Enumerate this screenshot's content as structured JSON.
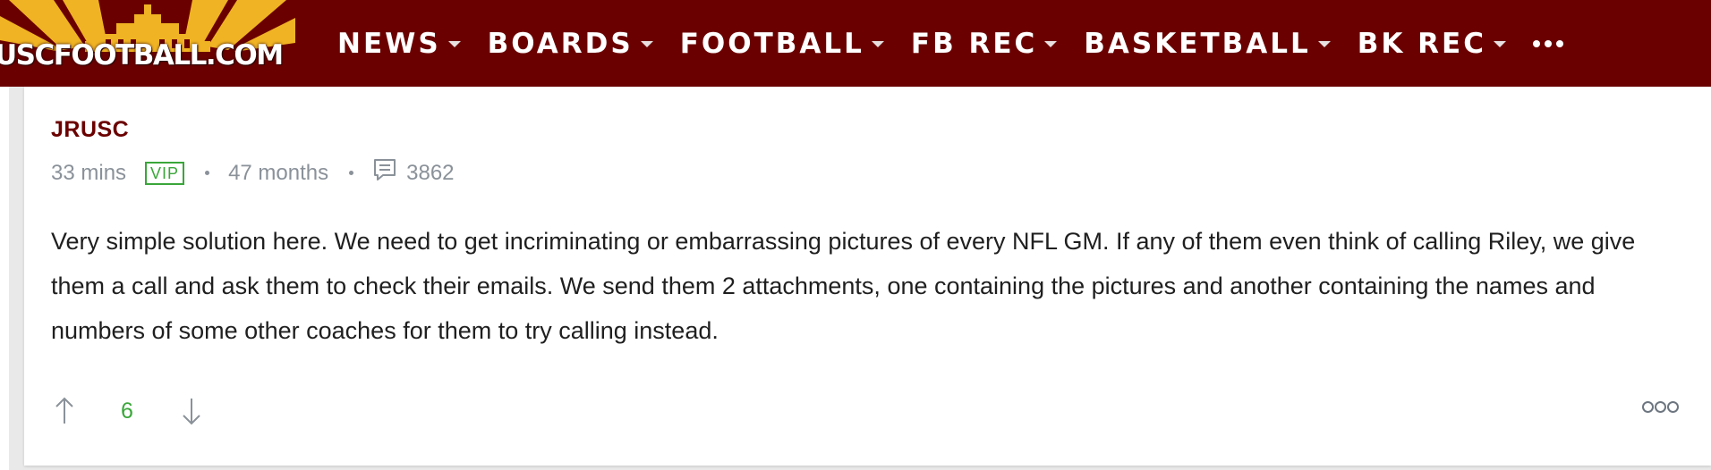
{
  "site": {
    "logo_text": "USCFOOTBALL.COM",
    "colors": {
      "brand": "#6b0000",
      "accent_gold": "#f0b323",
      "vip_green": "#3aa63a",
      "meta_gray": "#8a9199"
    }
  },
  "nav": {
    "items": [
      {
        "label": "NEWS"
      },
      {
        "label": "BOARDS"
      },
      {
        "label": "FOOTBALL"
      },
      {
        "label": "FB REC"
      },
      {
        "label": "BASKETBALL"
      },
      {
        "label": "BK REC"
      }
    ],
    "more_icon": "more-horizontal-icon"
  },
  "post": {
    "username": "JRUSC",
    "time_ago": "33 mins",
    "badge": "VIP",
    "membership": "47 months",
    "post_count": "3862",
    "body": "Very simple solution here. We need to get incriminating or embarrassing pictures of every NFL GM. If any of them even think of calling Riley, we give them a call and ask them to check their emails. We send them 2 attachments, one containing the pictures and another containing the names and numbers of some other coaches for them to try calling instead.",
    "score": "6",
    "icons": {
      "upvote": "arrow-up-icon",
      "downvote": "arrow-down-icon",
      "posts": "comment-icon",
      "menu": "more-options-icon"
    }
  }
}
